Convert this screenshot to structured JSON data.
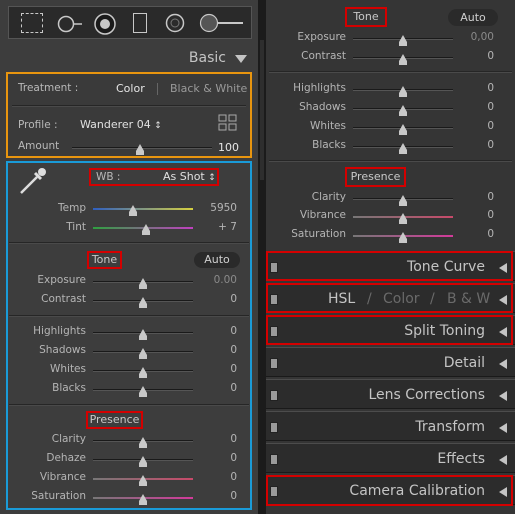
{
  "left": {
    "basic": {
      "title": "Basic"
    },
    "treatment": {
      "label": "Treatment :",
      "color": "Color",
      "bw": "Black & White"
    },
    "profile": {
      "label": "Profile :",
      "value": "Wanderer 04",
      "arrows": "↕"
    },
    "amount": {
      "label": "Amount",
      "value": "100"
    },
    "wb": {
      "label": "WB :",
      "value": "As Shot",
      "arrows": "↕"
    },
    "temp": {
      "label": "Temp",
      "value": "5950"
    },
    "tint": {
      "label": "Tint",
      "value": "+ 7"
    },
    "tone": {
      "title": "Tone",
      "auto": "Auto"
    },
    "exposure": {
      "label": "Exposure",
      "value": "0.00"
    },
    "contrast": {
      "label": "Contrast",
      "value": "0"
    },
    "highlights": {
      "label": "Highlights",
      "value": "0"
    },
    "shadows": {
      "label": "Shadows",
      "value": "0"
    },
    "whites": {
      "label": "Whites",
      "value": "0"
    },
    "blacks": {
      "label": "Blacks",
      "value": "0"
    },
    "presence": {
      "title": "Presence"
    },
    "clarity": {
      "label": "Clarity",
      "value": "0"
    },
    "dehaze": {
      "label": "Dehaze",
      "value": "0"
    },
    "vibrance": {
      "label": "Vibrance",
      "value": "0"
    },
    "saturation": {
      "label": "Saturation",
      "value": "0"
    }
  },
  "right": {
    "tone": {
      "title": "Tone",
      "auto": "Auto"
    },
    "exposure": {
      "label": "Exposure",
      "value": "0,00"
    },
    "contrast": {
      "label": "Contrast",
      "value": "0"
    },
    "highlights": {
      "label": "Highlights",
      "value": "0"
    },
    "shadows": {
      "label": "Shadows",
      "value": "0"
    },
    "whites": {
      "label": "Whites",
      "value": "0"
    },
    "blacks": {
      "label": "Blacks",
      "value": "0"
    },
    "presence": {
      "title": "Presence"
    },
    "clarity": {
      "label": "Clarity",
      "value": "0"
    },
    "vibrance": {
      "label": "Vibrance",
      "value": "0"
    },
    "saturation": {
      "label": "Saturation",
      "value": "0"
    },
    "panels": {
      "tone_curve": "Tone Curve",
      "hsl": "HSL",
      "hsl_sep": "/",
      "color": "Color",
      "bw": "B & W",
      "split_toning": "Split Toning",
      "detail": "Detail",
      "lens_corrections": "Lens Corrections",
      "transform": "Transform",
      "effects": "Effects",
      "camera_calibration": "Camera Calibration"
    }
  },
  "colors": {
    "orange_outline": "#e8950f",
    "blue_outline": "#1a9bd8",
    "red_outline": "#d40000"
  }
}
